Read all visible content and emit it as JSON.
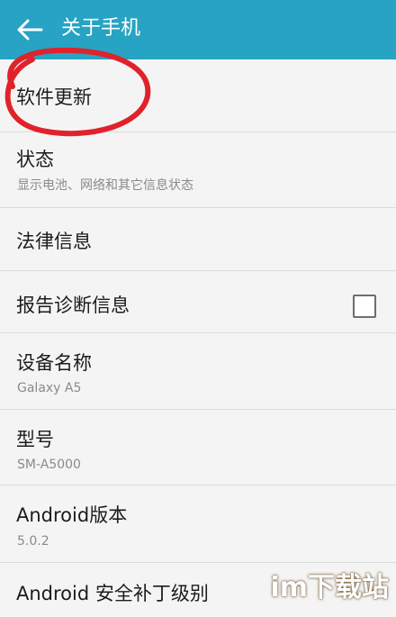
{
  "header": {
    "title": "关于手机",
    "back_icon": "arrow-left-icon"
  },
  "items": [
    {
      "label": "软件更新"
    },
    {
      "label": "状态",
      "sub": "显示电池、网络和其它信息状态"
    },
    {
      "label": "法律信息"
    },
    {
      "label": "报告诊断信息",
      "checked": false
    },
    {
      "label": "设备名称",
      "sub": "Galaxy A5"
    },
    {
      "label": "型号",
      "sub": "SM-A5000"
    },
    {
      "label": "Android版本",
      "sub": "5.0.2"
    },
    {
      "label": "Android 安全补丁级别"
    }
  ],
  "watermark": "im下载站",
  "colors": {
    "header": "#27a3c3",
    "annotation": "#e0222b"
  }
}
